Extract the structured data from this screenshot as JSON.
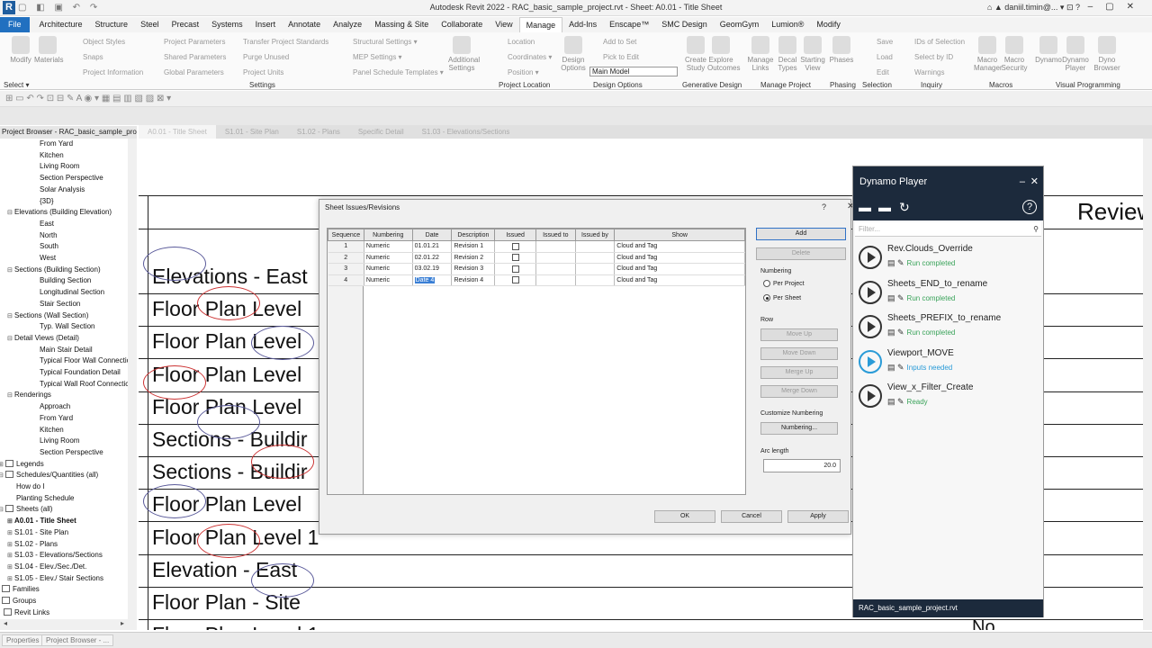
{
  "window": {
    "title": "Autodesk Revit 2022 - RAC_basic_sample_project.rvt - Sheet: A0.01 - Title Sheet",
    "user": "daniil.timin@..."
  },
  "menu_tabs": [
    "File",
    "Architecture",
    "Structure",
    "Steel",
    "Precast",
    "Systems",
    "Insert",
    "Annotate",
    "Analyze",
    "Massing & Site",
    "Collaborate",
    "View",
    "Manage",
    "Add-Ins",
    "Enscape™",
    "SMC Design",
    "GeomGym",
    "Lumion®",
    "Modify"
  ],
  "ribbon": {
    "select_label": "Select ▾",
    "buttons": [
      "Modify",
      "Materials",
      "Additional Settings",
      "Design Options",
      "Create Study",
      "Explore Outcomes",
      "Manage Links",
      "Decal Types",
      "Starting View",
      "Phases",
      "Dynamo",
      "Dynamo Player",
      "Dyno Browser",
      "Macro Manager",
      "Macro Security"
    ],
    "small_items": [
      "Object Styles",
      "Snaps",
      "Project Information",
      "Project Parameters",
      "Shared Parameters",
      "Global Parameters",
      "Transfer Project Standards",
      "Purge Unused",
      "Project Units",
      "Structural Settings ▾",
      "MEP Settings ▾",
      "Panel Schedule Templates ▾",
      "Location",
      "Coordinates ▾",
      "Position ▾",
      "Add to Set",
      "Pick to Edit",
      "Save",
      "Load",
      "Edit",
      "IDs of Selection",
      "Select by ID",
      "Warnings"
    ],
    "design_option_value": "Main Model",
    "groups": [
      "Settings",
      "Project Location",
      "Design Options",
      "Generative Design",
      "Manage Project",
      "Phasing",
      "Selection",
      "Inquiry",
      "Macros",
      "Visual Programming"
    ]
  },
  "project_browser": {
    "title": "Project Browser - RAC_basic_sample_pro...",
    "items": [
      {
        "label": "From Yard",
        "indent": 3,
        "toggle": ""
      },
      {
        "label": "Kitchen",
        "indent": 3,
        "toggle": ""
      },
      {
        "label": "Living Room",
        "indent": 3,
        "toggle": ""
      },
      {
        "label": "Section Perspective",
        "indent": 3,
        "toggle": ""
      },
      {
        "label": "Solar Analysis",
        "indent": 3,
        "toggle": ""
      },
      {
        "label": "{3D}",
        "indent": 3,
        "toggle": ""
      },
      {
        "label": "Elevations (Building Elevation)",
        "indent": 2,
        "toggle": "⊟"
      },
      {
        "label": "East",
        "indent": 3,
        "toggle": ""
      },
      {
        "label": "North",
        "indent": 3,
        "toggle": ""
      },
      {
        "label": "South",
        "indent": 3,
        "toggle": ""
      },
      {
        "label": "West",
        "indent": 3,
        "toggle": ""
      },
      {
        "label": "Sections (Building Section)",
        "indent": 2,
        "toggle": "⊟"
      },
      {
        "label": "Building Section",
        "indent": 3,
        "toggle": ""
      },
      {
        "label": "Longitudinal Section",
        "indent": 3,
        "toggle": ""
      },
      {
        "label": "Stair Section",
        "indent": 3,
        "toggle": ""
      },
      {
        "label": "Sections (Wall Section)",
        "indent": 2,
        "toggle": "⊟"
      },
      {
        "label": "Typ. Wall Section",
        "indent": 3,
        "toggle": ""
      },
      {
        "label": "Detail Views (Detail)",
        "indent": 2,
        "toggle": "⊟"
      },
      {
        "label": "Main Stair Detail",
        "indent": 3,
        "toggle": ""
      },
      {
        "label": "Typical Floor Wall Connectic",
        "indent": 3,
        "toggle": ""
      },
      {
        "label": "Typical Foundation Detail",
        "indent": 3,
        "toggle": ""
      },
      {
        "label": "Typical Wall Roof Connectic",
        "indent": 3,
        "toggle": ""
      },
      {
        "label": "Renderings",
        "indent": 2,
        "toggle": "⊟"
      },
      {
        "label": "Approach",
        "indent": 3,
        "toggle": ""
      },
      {
        "label": "From Yard",
        "indent": 3,
        "toggle": ""
      },
      {
        "label": "Kitchen",
        "indent": 3,
        "toggle": ""
      },
      {
        "label": "Living Room",
        "indent": 3,
        "toggle": ""
      },
      {
        "label": "Section Perspective",
        "indent": 3,
        "toggle": ""
      },
      {
        "label": "Legends",
        "indent": 1,
        "toggle": "⊞",
        "icon": true
      },
      {
        "label": "Schedules/Quantities (all)",
        "indent": 1,
        "toggle": "⊟",
        "icon": true
      },
      {
        "label": "How do I",
        "indent": 2,
        "toggle": ""
      },
      {
        "label": "Planting Schedule",
        "indent": 2,
        "toggle": ""
      },
      {
        "label": "Sheets (all)",
        "indent": 1,
        "toggle": "⊟",
        "icon": true
      },
      {
        "label": "A0.01 - Title Sheet",
        "indent": 2,
        "toggle": "⊞",
        "bold": true
      },
      {
        "label": "S1.01 - Site Plan",
        "indent": 2,
        "toggle": "⊞"
      },
      {
        "label": "S1.02 - Plans",
        "indent": 2,
        "toggle": "⊞"
      },
      {
        "label": "S1.03 - Elevations/Sections",
        "indent": 2,
        "toggle": "⊞"
      },
      {
        "label": "S1.04 - Elev./Sec./Det.",
        "indent": 2,
        "toggle": "⊞"
      },
      {
        "label": "S1.05 - Elev./ Stair Sections",
        "indent": 2,
        "toggle": "⊞"
      },
      {
        "label": "Families",
        "indent": 0,
        "toggle": "⊞",
        "icon": true
      },
      {
        "label": "Groups",
        "indent": 0,
        "toggle": "⊞",
        "icon": true
      },
      {
        "label": "Revit Links",
        "indent": 0,
        "toggle": "",
        "icon": true
      }
    ]
  },
  "bottom_tabs": [
    "Properties",
    "Project Browser - ..."
  ],
  "view_tabs": [
    "A0.01 - Title Sheet",
    "S1.01 - Site Plan",
    "S1.02 - Plans",
    "Specific Detail",
    "S1.03 - Elevations/Sections"
  ],
  "sheet": {
    "rows": [
      "Elevations - East",
      "Floor Plan Level",
      "Floor Plan Level",
      "Floor Plan Level",
      "Floor Plan Level",
      "Sections - Buildir",
      "Sections - Buildir",
      "Floor Plan Level",
      "Floor Plan Level 1",
      "Elevation - East",
      "Floor Plan - Site",
      "Floor Plan Level 1"
    ],
    "review_label": "Review",
    "no_label": "No"
  },
  "dialog": {
    "title": "Sheet Issues/Revisions",
    "help": "?",
    "close": "✕",
    "columns": [
      "Sequence",
      "Numbering",
      "Date",
      "Description",
      "Issued",
      "Issued to",
      "Issued by",
      "Show"
    ],
    "rows": [
      {
        "seq": "1",
        "numbering": "Numeric",
        "date": "01.01.21",
        "description": "Revision 1",
        "issued_to": "",
        "issued_by": "",
        "show": "Cloud and Tag"
      },
      {
        "seq": "2",
        "numbering": "Numeric",
        "date": "02.01.22",
        "description": "Revision 2",
        "issued_to": "",
        "issued_by": "",
        "show": "Cloud and Tag"
      },
      {
        "seq": "3",
        "numbering": "Numeric",
        "date": "03.02.19",
        "description": "Revision 3",
        "issued_to": "",
        "issued_by": "",
        "show": "Cloud and Tag"
      },
      {
        "seq": "4",
        "numbering": "Numeric",
        "date": "Date 4",
        "description": "Revision 4",
        "issued_to": "",
        "issued_by": "",
        "show": "Cloud and Tag"
      }
    ],
    "buttons": {
      "add": "Add",
      "delete": "Delete",
      "move_up": "Move Up",
      "move_down": "Move Down",
      "merge_up": "Merge Up",
      "merge_down": "Merge Down",
      "numbering": "Numbering...",
      "ok": "OK",
      "cancel": "Cancel",
      "apply": "Apply"
    },
    "numbering_label": "Numbering",
    "per_project": "Per Project",
    "per_sheet": "Per Sheet",
    "row_label": "Row",
    "customize_label": "Customize Numbering",
    "arc_label": "Arc length",
    "arc_value": "20.0"
  },
  "dynamo": {
    "title": "Dynamo Player",
    "filter_placeholder": "Filter...",
    "scripts": [
      {
        "name": "Rev.Clouds_Override",
        "status": "Run completed",
        "color": "#3aa35a",
        "blue": false
      },
      {
        "name": "Sheets_END_to_rename",
        "status": "Run completed",
        "color": "#3aa35a",
        "blue": false
      },
      {
        "name": "Sheets_PREFIX_to_rename",
        "status": "Run completed",
        "color": "#3aa35a",
        "blue": false
      },
      {
        "name": "Viewport_MOVE",
        "status": "Inputs needed",
        "color": "#2a9bd7",
        "blue": true
      },
      {
        "name": "View_x_Filter_Create",
        "status": "Ready",
        "color": "#3aa35a",
        "blue": false
      }
    ],
    "footer": "RAC_basic_sample_project.rvt"
  }
}
